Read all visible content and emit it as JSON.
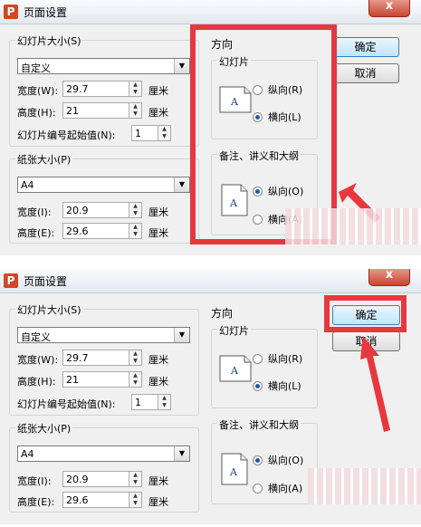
{
  "dialogs": [
    {
      "title": "页面设置",
      "app_icon": "P",
      "close": "x",
      "slide_size": {
        "group_title": "幻灯片大小(S)",
        "select": "自定义",
        "width_label": "宽度(W):",
        "width_value": "29.7",
        "height_label": "高度(H):",
        "height_value": "21",
        "unit": "厘米",
        "start_num_label": "幻灯片编号起始值(N):",
        "start_num_value": "1"
      },
      "paper_size": {
        "group_title": "纸张大小(P)",
        "select": "A4",
        "width_label": "宽度(I):",
        "width_value": "20.9",
        "height_label": "高度(E):",
        "height_value": "29.6",
        "unit": "厘米"
      },
      "orientation": {
        "title": "方向",
        "slides_title": "幻灯片",
        "slides_portrait": "纵向(R)",
        "slides_landscape": "横向(L)",
        "notes_title": "备注、讲义和大纲",
        "notes_portrait": "纵向(O)",
        "notes_landscape": "横向(A)"
      },
      "ok": "确定",
      "cancel": "取消"
    },
    {
      "title": "页面设置",
      "app_icon": "P",
      "close": "x",
      "slide_size": {
        "group_title": "幻灯片大小(S)",
        "select": "自定义",
        "width_label": "宽度(W):",
        "width_value": "29.7",
        "height_label": "高度(H):",
        "height_value": "21",
        "unit": "厘米",
        "start_num_label": "幻灯片编号起始值(N):",
        "start_num_value": "1"
      },
      "paper_size": {
        "group_title": "纸张大小(P)",
        "select": "A4",
        "width_label": "宽度(I):",
        "width_value": "20.9",
        "height_label": "高度(E):",
        "height_value": "29.6",
        "unit": "厘米"
      },
      "orientation": {
        "title": "方向",
        "slides_title": "幻灯片",
        "slides_portrait": "纵向(R)",
        "slides_landscape": "横向(L)",
        "notes_title": "备注、讲义和大纲",
        "notes_portrait": "纵向(O)",
        "notes_landscape": "横向(A)"
      },
      "ok": "确定",
      "cancel": "取消"
    }
  ],
  "slide_icon_letter": "A",
  "colors": {
    "highlight": "#e8373f",
    "accent": "#1f5aa6"
  }
}
